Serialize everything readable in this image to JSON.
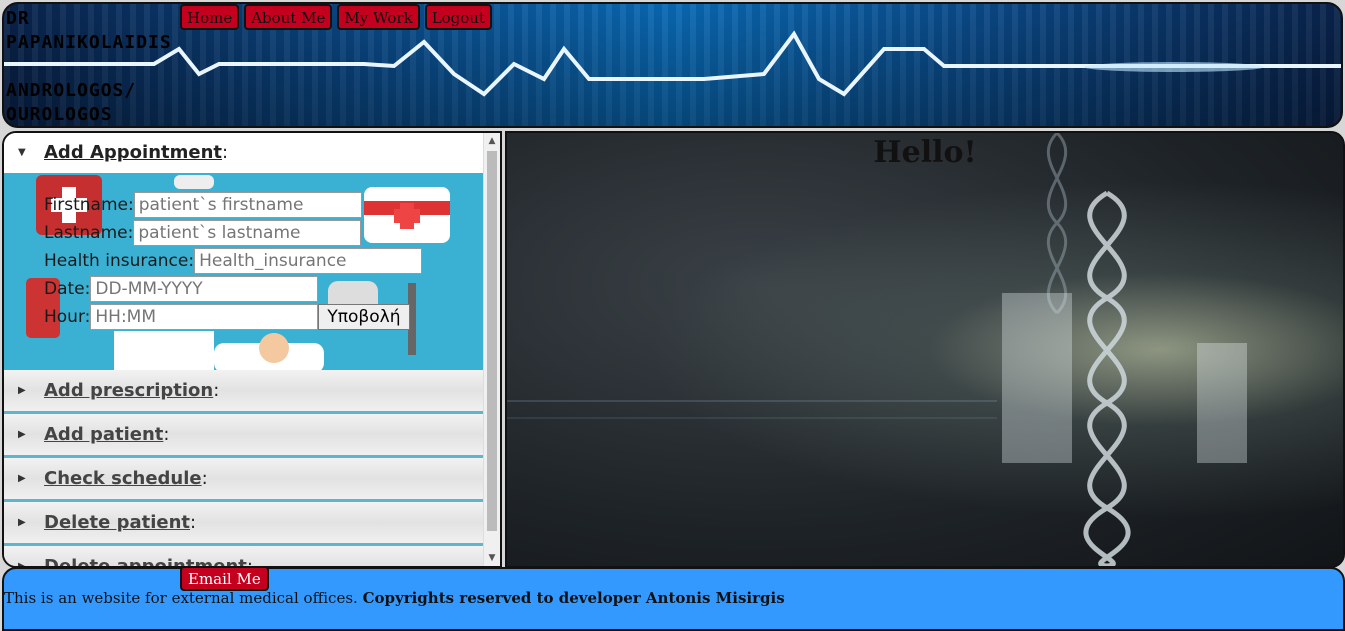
{
  "header": {
    "brand_line1": "DR",
    "brand_line2": "PAPANIKOLAIDIS",
    "brand_line3": "ANDROLOGOS/",
    "brand_line4": "OUROLOGOS",
    "nav": [
      "Home",
      "About Me",
      "My Work",
      "Logout"
    ]
  },
  "accordion": {
    "open": {
      "label": "Add Appointment",
      "suffix": ":",
      "form": {
        "firstname_label": "Firstname:",
        "firstname_placeholder": "patient`s firstname",
        "lastname_label": "Lastname:",
        "lastname_placeholder": "patient`s lastname",
        "insurance_label": "Health insurance:",
        "insurance_placeholder": "Health_insurance",
        "date_label": "Date:",
        "date_placeholder": "DD-MM-YYYY",
        "hour_label": "Hour:",
        "hour_placeholder": "HH:MM",
        "submit_label": "Υποβολή"
      }
    },
    "closed": [
      {
        "label": "Add prescription",
        "suffix": ":"
      },
      {
        "label": "Add patient",
        "suffix": ":"
      },
      {
        "label": "Check schedule",
        "suffix": ":"
      },
      {
        "label": "Delete patient",
        "suffix": ":"
      },
      {
        "label": "Delete appointment",
        "suffix": ":"
      }
    ]
  },
  "main": {
    "greeting": "Hello!"
  },
  "footer": {
    "email_label": "Email Me",
    "text": "This is an website for external medical offices. ",
    "copyright": "Copyrights reserved to developer Antonis Misirgis"
  },
  "colors": {
    "nav_button": "#c4001e",
    "footer_bg": "#3399ff",
    "accordion_accent": "#5fb5cc"
  }
}
